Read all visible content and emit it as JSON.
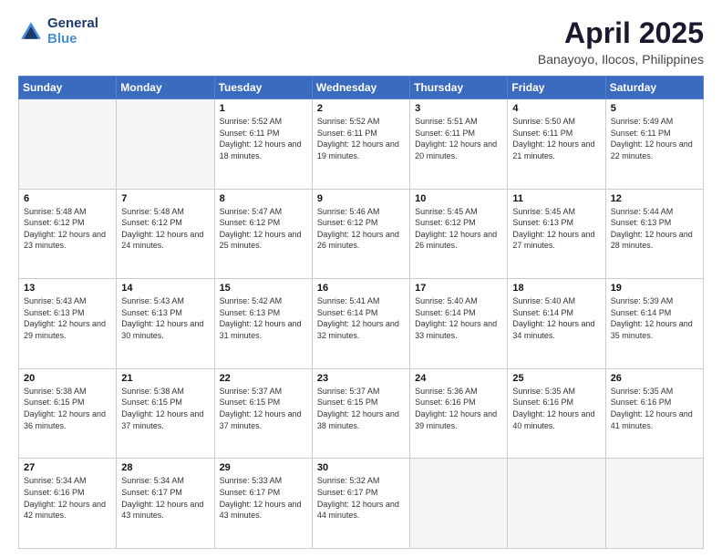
{
  "logo": {
    "line1": "General",
    "line2": "Blue"
  },
  "title": "April 2025",
  "subtitle": "Banayoyo, Ilocos, Philippines",
  "days_of_week": [
    "Sunday",
    "Monday",
    "Tuesday",
    "Wednesday",
    "Thursday",
    "Friday",
    "Saturday"
  ],
  "weeks": [
    [
      {
        "day": "",
        "sunrise": "",
        "sunset": "",
        "daylight": ""
      },
      {
        "day": "",
        "sunrise": "",
        "sunset": "",
        "daylight": ""
      },
      {
        "day": "1",
        "sunrise": "Sunrise: 5:52 AM",
        "sunset": "Sunset: 6:11 PM",
        "daylight": "Daylight: 12 hours and 18 minutes."
      },
      {
        "day": "2",
        "sunrise": "Sunrise: 5:52 AM",
        "sunset": "Sunset: 6:11 PM",
        "daylight": "Daylight: 12 hours and 19 minutes."
      },
      {
        "day": "3",
        "sunrise": "Sunrise: 5:51 AM",
        "sunset": "Sunset: 6:11 PM",
        "daylight": "Daylight: 12 hours and 20 minutes."
      },
      {
        "day": "4",
        "sunrise": "Sunrise: 5:50 AM",
        "sunset": "Sunset: 6:11 PM",
        "daylight": "Daylight: 12 hours and 21 minutes."
      },
      {
        "day": "5",
        "sunrise": "Sunrise: 5:49 AM",
        "sunset": "Sunset: 6:11 PM",
        "daylight": "Daylight: 12 hours and 22 minutes."
      }
    ],
    [
      {
        "day": "6",
        "sunrise": "Sunrise: 5:48 AM",
        "sunset": "Sunset: 6:12 PM",
        "daylight": "Daylight: 12 hours and 23 minutes."
      },
      {
        "day": "7",
        "sunrise": "Sunrise: 5:48 AM",
        "sunset": "Sunset: 6:12 PM",
        "daylight": "Daylight: 12 hours and 24 minutes."
      },
      {
        "day": "8",
        "sunrise": "Sunrise: 5:47 AM",
        "sunset": "Sunset: 6:12 PM",
        "daylight": "Daylight: 12 hours and 25 minutes."
      },
      {
        "day": "9",
        "sunrise": "Sunrise: 5:46 AM",
        "sunset": "Sunset: 6:12 PM",
        "daylight": "Daylight: 12 hours and 26 minutes."
      },
      {
        "day": "10",
        "sunrise": "Sunrise: 5:45 AM",
        "sunset": "Sunset: 6:12 PM",
        "daylight": "Daylight: 12 hours and 26 minutes."
      },
      {
        "day": "11",
        "sunrise": "Sunrise: 5:45 AM",
        "sunset": "Sunset: 6:13 PM",
        "daylight": "Daylight: 12 hours and 27 minutes."
      },
      {
        "day": "12",
        "sunrise": "Sunrise: 5:44 AM",
        "sunset": "Sunset: 6:13 PM",
        "daylight": "Daylight: 12 hours and 28 minutes."
      }
    ],
    [
      {
        "day": "13",
        "sunrise": "Sunrise: 5:43 AM",
        "sunset": "Sunset: 6:13 PM",
        "daylight": "Daylight: 12 hours and 29 minutes."
      },
      {
        "day": "14",
        "sunrise": "Sunrise: 5:43 AM",
        "sunset": "Sunset: 6:13 PM",
        "daylight": "Daylight: 12 hours and 30 minutes."
      },
      {
        "day": "15",
        "sunrise": "Sunrise: 5:42 AM",
        "sunset": "Sunset: 6:13 PM",
        "daylight": "Daylight: 12 hours and 31 minutes."
      },
      {
        "day": "16",
        "sunrise": "Sunrise: 5:41 AM",
        "sunset": "Sunset: 6:14 PM",
        "daylight": "Daylight: 12 hours and 32 minutes."
      },
      {
        "day": "17",
        "sunrise": "Sunrise: 5:40 AM",
        "sunset": "Sunset: 6:14 PM",
        "daylight": "Daylight: 12 hours and 33 minutes."
      },
      {
        "day": "18",
        "sunrise": "Sunrise: 5:40 AM",
        "sunset": "Sunset: 6:14 PM",
        "daylight": "Daylight: 12 hours and 34 minutes."
      },
      {
        "day": "19",
        "sunrise": "Sunrise: 5:39 AM",
        "sunset": "Sunset: 6:14 PM",
        "daylight": "Daylight: 12 hours and 35 minutes."
      }
    ],
    [
      {
        "day": "20",
        "sunrise": "Sunrise: 5:38 AM",
        "sunset": "Sunset: 6:15 PM",
        "daylight": "Daylight: 12 hours and 36 minutes."
      },
      {
        "day": "21",
        "sunrise": "Sunrise: 5:38 AM",
        "sunset": "Sunset: 6:15 PM",
        "daylight": "Daylight: 12 hours and 37 minutes."
      },
      {
        "day": "22",
        "sunrise": "Sunrise: 5:37 AM",
        "sunset": "Sunset: 6:15 PM",
        "daylight": "Daylight: 12 hours and 37 minutes."
      },
      {
        "day": "23",
        "sunrise": "Sunrise: 5:37 AM",
        "sunset": "Sunset: 6:15 PM",
        "daylight": "Daylight: 12 hours and 38 minutes."
      },
      {
        "day": "24",
        "sunrise": "Sunrise: 5:36 AM",
        "sunset": "Sunset: 6:16 PM",
        "daylight": "Daylight: 12 hours and 39 minutes."
      },
      {
        "day": "25",
        "sunrise": "Sunrise: 5:35 AM",
        "sunset": "Sunset: 6:16 PM",
        "daylight": "Daylight: 12 hours and 40 minutes."
      },
      {
        "day": "26",
        "sunrise": "Sunrise: 5:35 AM",
        "sunset": "Sunset: 6:16 PM",
        "daylight": "Daylight: 12 hours and 41 minutes."
      }
    ],
    [
      {
        "day": "27",
        "sunrise": "Sunrise: 5:34 AM",
        "sunset": "Sunset: 6:16 PM",
        "daylight": "Daylight: 12 hours and 42 minutes."
      },
      {
        "day": "28",
        "sunrise": "Sunrise: 5:34 AM",
        "sunset": "Sunset: 6:17 PM",
        "daylight": "Daylight: 12 hours and 43 minutes."
      },
      {
        "day": "29",
        "sunrise": "Sunrise: 5:33 AM",
        "sunset": "Sunset: 6:17 PM",
        "daylight": "Daylight: 12 hours and 43 minutes."
      },
      {
        "day": "30",
        "sunrise": "Sunrise: 5:32 AM",
        "sunset": "Sunset: 6:17 PM",
        "daylight": "Daylight: 12 hours and 44 minutes."
      },
      {
        "day": "",
        "sunrise": "",
        "sunset": "",
        "daylight": ""
      },
      {
        "day": "",
        "sunrise": "",
        "sunset": "",
        "daylight": ""
      },
      {
        "day": "",
        "sunrise": "",
        "sunset": "",
        "daylight": ""
      }
    ]
  ]
}
